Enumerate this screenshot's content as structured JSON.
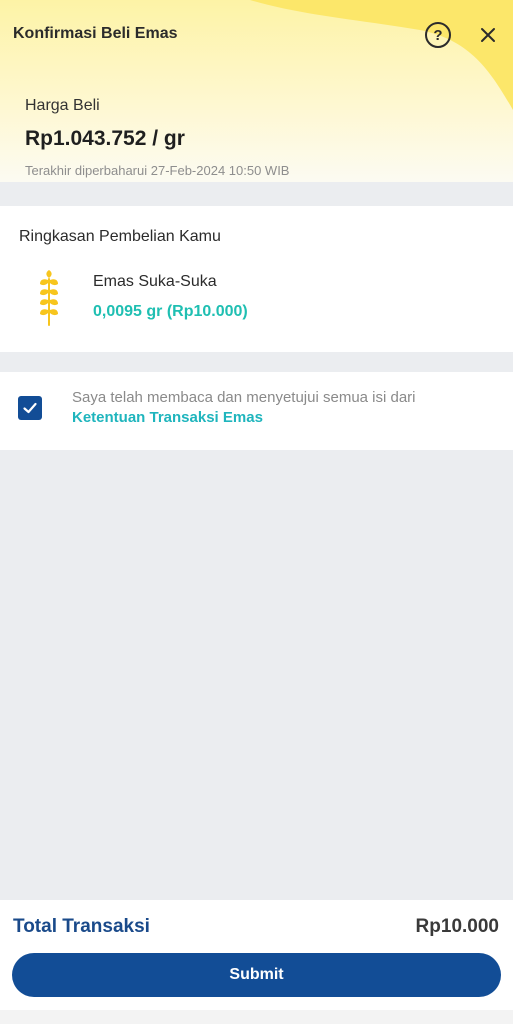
{
  "header": {
    "title": "Konfirmasi Beli Emas",
    "help_icon": "question-circle-icon",
    "help_glyph": "?",
    "close_icon": "close-icon",
    "accent_color": "#fdf3a6"
  },
  "price": {
    "label": "Harga Beli",
    "value": "Rp1.043.752 / gr",
    "updated": "Terakhir diperbaharui 27-Feb-2024 10:50 WIB"
  },
  "summary": {
    "title": "Ringkasan Pembelian Kamu",
    "product_icon": "gold-wheat-icon",
    "product_name": "Emas Suka-Suka",
    "product_amount": "0,0095 gr (Rp10.000)"
  },
  "agreement": {
    "checked": true,
    "text": "Saya telah membaca dan menyetujui semua isi dari",
    "link": "Ketentuan Transaksi Emas"
  },
  "footer": {
    "total_label": "Total Transaksi",
    "total_value": "Rp10.000",
    "submit_label": "Submit",
    "primary_color": "#124d96"
  }
}
